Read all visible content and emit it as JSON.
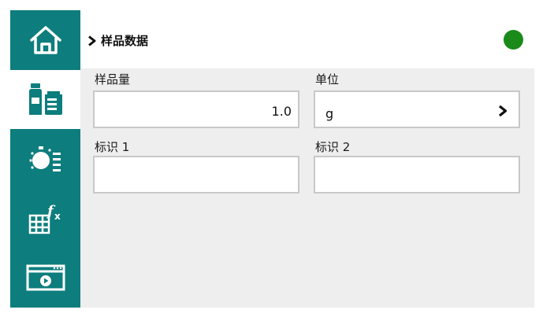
{
  "sidebar": {
    "items": [
      {
        "icon": "home-icon"
      },
      {
        "icon": "sample-bottles-icon",
        "active": true
      },
      {
        "icon": "timer-settings-icon"
      },
      {
        "icon": "table-function-icon"
      },
      {
        "icon": "media-window-icon"
      }
    ]
  },
  "header": {
    "breadcrumb_title": "样品数据",
    "status_color": "#1a8a1a"
  },
  "form": {
    "sample_amount_label": "样品量",
    "sample_amount_value": "1.0",
    "unit_label": "单位",
    "unit_value": "g",
    "id1_label": "标识 1",
    "id1_value": "",
    "id2_label": "标识 2",
    "id2_value": ""
  },
  "colors": {
    "accent": "#0d7d7d",
    "content_bg": "#eeeeee"
  }
}
